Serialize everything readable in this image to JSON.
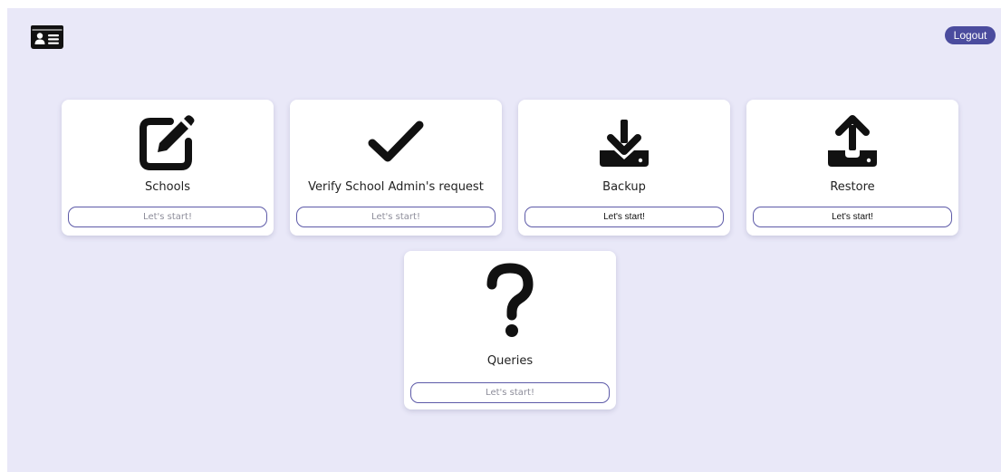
{
  "header": {
    "logo_icon": "id-card-icon",
    "logout_label": "Logout"
  },
  "cards": [
    {
      "icon": "edit-icon",
      "title": "Schools",
      "button_label": "Let's start!"
    },
    {
      "icon": "check-icon",
      "title": "Verify School Admin's request",
      "button_label": "Let's start!"
    },
    {
      "icon": "download-icon",
      "title": "Backup",
      "button_label": "Let's start!"
    },
    {
      "icon": "upload-icon",
      "title": "Restore",
      "button_label": "Let's start!"
    },
    {
      "icon": "question-icon",
      "title": "Queries",
      "button_label": "Let's start!"
    }
  ],
  "colors": {
    "background": "#e9e8f8",
    "accent": "#4b4c9e",
    "button_border": "#5d5aa8",
    "card": "#ffffff"
  }
}
